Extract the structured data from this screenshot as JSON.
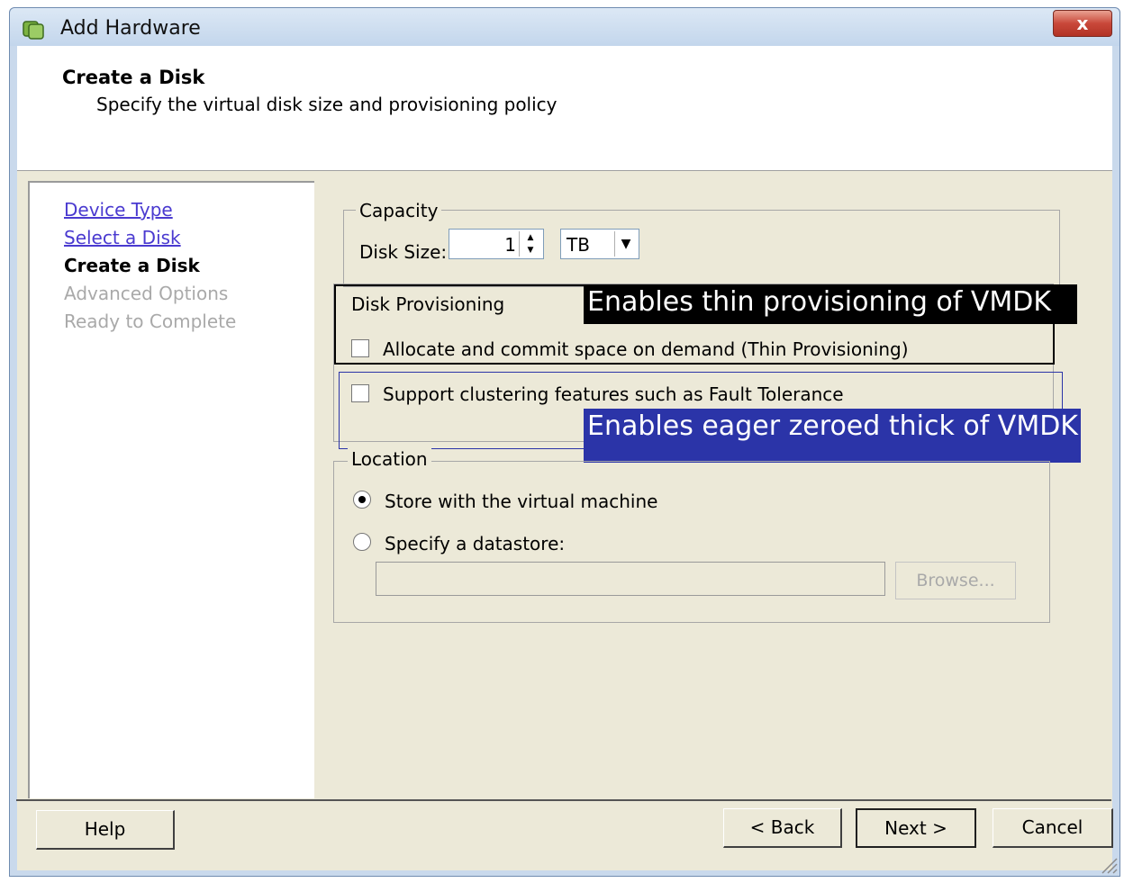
{
  "window": {
    "title": "Add Hardware",
    "close_label": "x"
  },
  "header": {
    "title": "Create a Disk",
    "subtitle": "Specify the virtual disk size and provisioning policy"
  },
  "sidebar": {
    "items": [
      {
        "label": "Device Type",
        "state": "link"
      },
      {
        "label": "Select a Disk",
        "state": "link"
      },
      {
        "label": "Create a Disk",
        "state": "current"
      },
      {
        "label": "Advanced Options",
        "state": "disabled"
      },
      {
        "label": "Ready to Complete",
        "state": "disabled"
      }
    ]
  },
  "capacity": {
    "legend": "Capacity",
    "disk_size_label": "Disk Size:",
    "disk_size_value": "1",
    "unit_value": "TB"
  },
  "provisioning": {
    "legend": "Disk Provisioning",
    "thin_label": "Allocate and commit space on demand (Thin Provisioning)",
    "thin_checked": false,
    "cluster_label": "Support clustering features such as Fault Tolerance",
    "cluster_checked": false
  },
  "annotations": {
    "thin": {
      "text": "Enables thin provisioning of VMDK",
      "color": "#000000"
    },
    "eager": {
      "text": "Enables eager zeroed thick of VMDK",
      "color": "#2b34a8"
    }
  },
  "location": {
    "legend": "Location",
    "store_with_vm_label": "Store with the virtual machine",
    "store_with_vm_selected": true,
    "specify_datastore_label": "Specify a datastore:",
    "specify_datastore_selected": false,
    "datastore_value": "",
    "browse_label": "Browse..."
  },
  "footer": {
    "help_label": "Help",
    "back_label": "< Back",
    "next_label": "Next >",
    "cancel_label": "Cancel"
  },
  "colors": {
    "link": "#4a3ad0",
    "disabled": "#a9a9a9",
    "dialog_bg": "#ece9d8"
  }
}
